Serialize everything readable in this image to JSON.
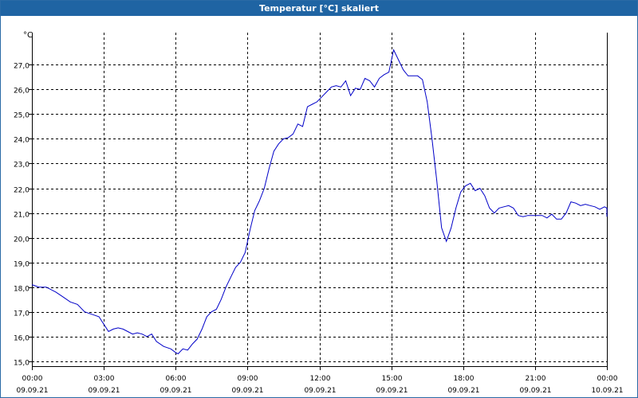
{
  "window": {
    "title": "Temperatur [°C] skaliert"
  },
  "chart_data": {
    "type": "line",
    "title": "Temperatur [°C] skaliert",
    "unit": "°C",
    "ylim": [
      14.8,
      28.3
    ],
    "yticks": [
      15.0,
      16.0,
      17.0,
      18.0,
      19.0,
      20.0,
      21.0,
      22.0,
      23.0,
      24.0,
      25.0,
      26.0,
      27.0
    ],
    "ytick_labels": [
      "15,0",
      "16,0",
      "17,0",
      "18,0",
      "19,0",
      "20,0",
      "21,0",
      "22,0",
      "23,0",
      "24,0",
      "25,0",
      "26,0",
      "27,0"
    ],
    "xlim": [
      0,
      24
    ],
    "xticks": [
      0,
      3,
      6,
      9,
      12,
      15,
      18,
      21,
      24
    ],
    "xtick_labels": [
      [
        "00:00",
        "09.09.21"
      ],
      [
        "03:00",
        "09.09.21"
      ],
      [
        "06:00",
        "09.09.21"
      ],
      [
        "09:00",
        "09.09.21"
      ],
      [
        "12:00",
        "09.09.21"
      ],
      [
        "15:00",
        "09.09.21"
      ],
      [
        "18:00",
        "09.09.21"
      ],
      [
        "21:00",
        "09.09.21"
      ],
      [
        "00:00",
        "10.09.21"
      ]
    ],
    "grid": true,
    "line_color": "#0000c8",
    "series": [
      {
        "points": [
          [
            0.0,
            18.1
          ],
          [
            0.3,
            18.0
          ],
          [
            0.6,
            18.0
          ],
          [
            1.0,
            17.8
          ],
          [
            1.3,
            17.6
          ],
          [
            1.6,
            17.4
          ],
          [
            1.9,
            17.3
          ],
          [
            2.2,
            17.0
          ],
          [
            2.5,
            16.9
          ],
          [
            2.8,
            16.8
          ],
          [
            3.0,
            16.5
          ],
          [
            3.2,
            16.2
          ],
          [
            3.4,
            16.3
          ],
          [
            3.6,
            16.35
          ],
          [
            3.8,
            16.3
          ],
          [
            4.0,
            16.2
          ],
          [
            4.2,
            16.1
          ],
          [
            4.4,
            16.15
          ],
          [
            4.6,
            16.1
          ],
          [
            4.8,
            16.0
          ],
          [
            5.0,
            16.1
          ],
          [
            5.2,
            15.8
          ],
          [
            5.5,
            15.6
          ],
          [
            5.8,
            15.5
          ],
          [
            6.0,
            15.35
          ],
          [
            6.1,
            15.3
          ],
          [
            6.3,
            15.5
          ],
          [
            6.5,
            15.45
          ],
          [
            6.7,
            15.7
          ],
          [
            6.9,
            15.9
          ],
          [
            7.1,
            16.3
          ],
          [
            7.3,
            16.8
          ],
          [
            7.5,
            17.0
          ],
          [
            7.7,
            17.1
          ],
          [
            7.9,
            17.5
          ],
          [
            8.1,
            18.0
          ],
          [
            8.3,
            18.4
          ],
          [
            8.5,
            18.8
          ],
          [
            8.7,
            19.0
          ],
          [
            8.9,
            19.4
          ],
          [
            9.1,
            20.3
          ],
          [
            9.3,
            21.1
          ],
          [
            9.5,
            21.5
          ],
          [
            9.7,
            22.0
          ],
          [
            9.9,
            22.8
          ],
          [
            10.1,
            23.5
          ],
          [
            10.3,
            23.8
          ],
          [
            10.5,
            24.0
          ],
          [
            10.7,
            24.05
          ],
          [
            10.9,
            24.2
          ],
          [
            11.1,
            24.6
          ],
          [
            11.3,
            24.5
          ],
          [
            11.5,
            25.3
          ],
          [
            11.7,
            25.4
          ],
          [
            11.9,
            25.5
          ],
          [
            12.1,
            25.7
          ],
          [
            12.3,
            25.9
          ],
          [
            12.5,
            26.1
          ],
          [
            12.7,
            26.15
          ],
          [
            12.9,
            26.1
          ],
          [
            13.1,
            26.35
          ],
          [
            13.3,
            25.75
          ],
          [
            13.5,
            26.05
          ],
          [
            13.7,
            26.0
          ],
          [
            13.9,
            26.45
          ],
          [
            14.1,
            26.35
          ],
          [
            14.3,
            26.1
          ],
          [
            14.5,
            26.45
          ],
          [
            14.7,
            26.6
          ],
          [
            14.9,
            26.7
          ],
          [
            15.1,
            27.6
          ],
          [
            15.3,
            27.2
          ],
          [
            15.5,
            26.8
          ],
          [
            15.7,
            26.55
          ],
          [
            15.9,
            26.55
          ],
          [
            16.1,
            26.55
          ],
          [
            16.3,
            26.4
          ],
          [
            16.5,
            25.5
          ],
          [
            16.7,
            24.0
          ],
          [
            16.9,
            22.3
          ],
          [
            17.1,
            20.4
          ],
          [
            17.3,
            19.85
          ],
          [
            17.5,
            20.4
          ],
          [
            17.7,
            21.2
          ],
          [
            17.9,
            21.85
          ],
          [
            18.1,
            22.1
          ],
          [
            18.3,
            22.2
          ],
          [
            18.5,
            21.9
          ],
          [
            18.7,
            22.0
          ],
          [
            18.9,
            21.7
          ],
          [
            19.1,
            21.2
          ],
          [
            19.3,
            21.0
          ],
          [
            19.5,
            21.2
          ],
          [
            19.7,
            21.25
          ],
          [
            19.9,
            21.3
          ],
          [
            20.1,
            21.2
          ],
          [
            20.3,
            20.9
          ],
          [
            20.5,
            20.85
          ],
          [
            20.7,
            20.9
          ],
          [
            20.9,
            20.9
          ],
          [
            21.1,
            20.9
          ],
          [
            21.3,
            20.9
          ],
          [
            21.5,
            20.8
          ],
          [
            21.7,
            20.95
          ],
          [
            21.9,
            20.75
          ],
          [
            22.1,
            20.75
          ],
          [
            22.3,
            21.0
          ],
          [
            22.5,
            21.45
          ],
          [
            22.7,
            21.4
          ],
          [
            22.9,
            21.3
          ],
          [
            23.1,
            21.35
          ],
          [
            23.3,
            21.3
          ],
          [
            23.5,
            21.25
          ],
          [
            23.7,
            21.15
          ],
          [
            23.9,
            21.25
          ],
          [
            24.1,
            21.2
          ],
          [
            24.3,
            21.2
          ],
          [
            24.5,
            21.1
          ],
          [
            24.7,
            20.9
          ],
          [
            24.9,
            20.85
          ],
          [
            25.1,
            20.85
          ]
        ]
      }
    ]
  }
}
